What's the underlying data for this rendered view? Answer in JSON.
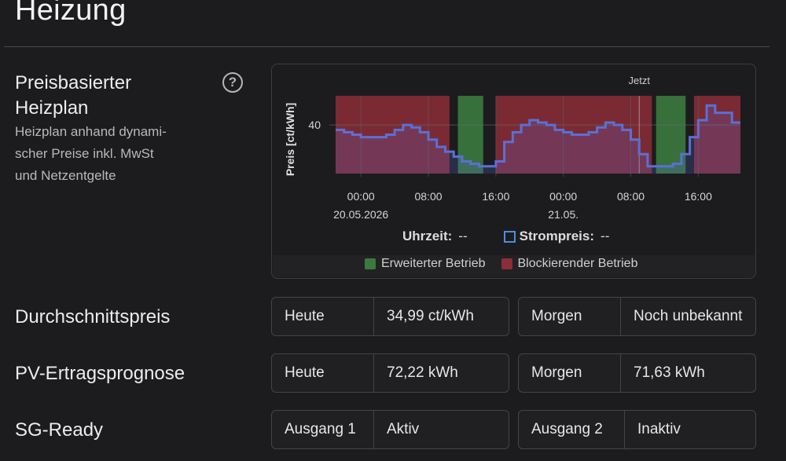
{
  "page": {
    "title": "Heizung"
  },
  "heating_plan": {
    "title_line1": "Preisbasierter",
    "title_line2": "Heizplan",
    "desc_line1": "Heizplan anhand dynami-",
    "desc_line2": "scher Preise inkl. MwSt",
    "desc_line3": "und Netzentgelte",
    "help_icon": "question-circle-icon"
  },
  "chart_data": {
    "type": "area",
    "ylabel": "Preis [ct/kWh]",
    "y_ticks": [
      "40"
    ],
    "ylim": [
      20,
      52
    ],
    "x_tick_labels": [
      "00:00",
      "08:00",
      "16:00",
      "00:00",
      "08:00",
      "16:00"
    ],
    "x_date_labels": [
      "20.05.2026",
      "21.05."
    ],
    "now_label": "Jetzt",
    "x_range_hours": [
      -3,
      45
    ],
    "series": [
      {
        "name": "Strompreis",
        "color": "#5b6fd6",
        "x": [
          -3,
          -2,
          -1,
          0,
          1,
          2,
          3,
          4,
          5,
          6,
          7,
          8,
          9,
          10,
          11,
          12,
          13,
          14,
          15,
          16,
          17,
          18,
          19,
          20,
          21,
          22,
          23,
          24,
          25,
          26,
          27,
          28,
          29,
          30,
          31,
          32,
          33,
          34,
          35,
          36,
          37,
          38,
          39,
          40,
          41,
          42,
          44
        ],
        "values": [
          38,
          37,
          36,
          35,
          35,
          35,
          36,
          38,
          40,
          39,
          37,
          34,
          31,
          29,
          27,
          25,
          24,
          23,
          23,
          25,
          33,
          37,
          40,
          42,
          41,
          40,
          38,
          37,
          36,
          36,
          37,
          39,
          41,
          40,
          38,
          34,
          28,
          23,
          23,
          23,
          24,
          28,
          35,
          42,
          48,
          45,
          41
        ]
      }
    ],
    "bands": [
      {
        "name": "Blockierender Betrieb",
        "color": "#8c2d37",
        "ranges": [
          [
            -3,
            10.5
          ],
          [
            16,
            34.5
          ],
          [
            39.5,
            45
          ]
        ]
      },
      {
        "name": "Erweiterter Betrieb",
        "color": "#3b7a3e",
        "ranges": [
          [
            11.5,
            14.5
          ],
          [
            35,
            38.5
          ]
        ]
      }
    ],
    "legend": [
      {
        "label": "Erweiterter Betrieb",
        "color": "#3b7a3e"
      },
      {
        "label": "Blockierender Betrieb",
        "color": "#8c2d37"
      }
    ],
    "legend_position": "bottom-center",
    "grid": true
  },
  "chart_info": {
    "time_label": "Uhrzeit:",
    "time_value": "--",
    "price_label": "Strompreis:",
    "price_value": "--"
  },
  "average_price": {
    "label": "Durchschnittspreis",
    "today_key": "Heute",
    "today_value": "34,99 ct/kWh",
    "tomorrow_key": "Morgen",
    "tomorrow_value": "Noch unbekannt"
  },
  "pv_forecast": {
    "label": "PV-Ertragsprognose",
    "today_key": "Heute",
    "today_value": "72,22 kWh",
    "tomorrow_key": "Morgen",
    "tomorrow_value": "71,63 kWh"
  },
  "sg_ready": {
    "label": "SG-Ready",
    "out1_key": "Ausgang 1",
    "out1_value": "Aktiv",
    "out2_key": "Ausgang 2",
    "out2_value": "Inaktiv"
  }
}
